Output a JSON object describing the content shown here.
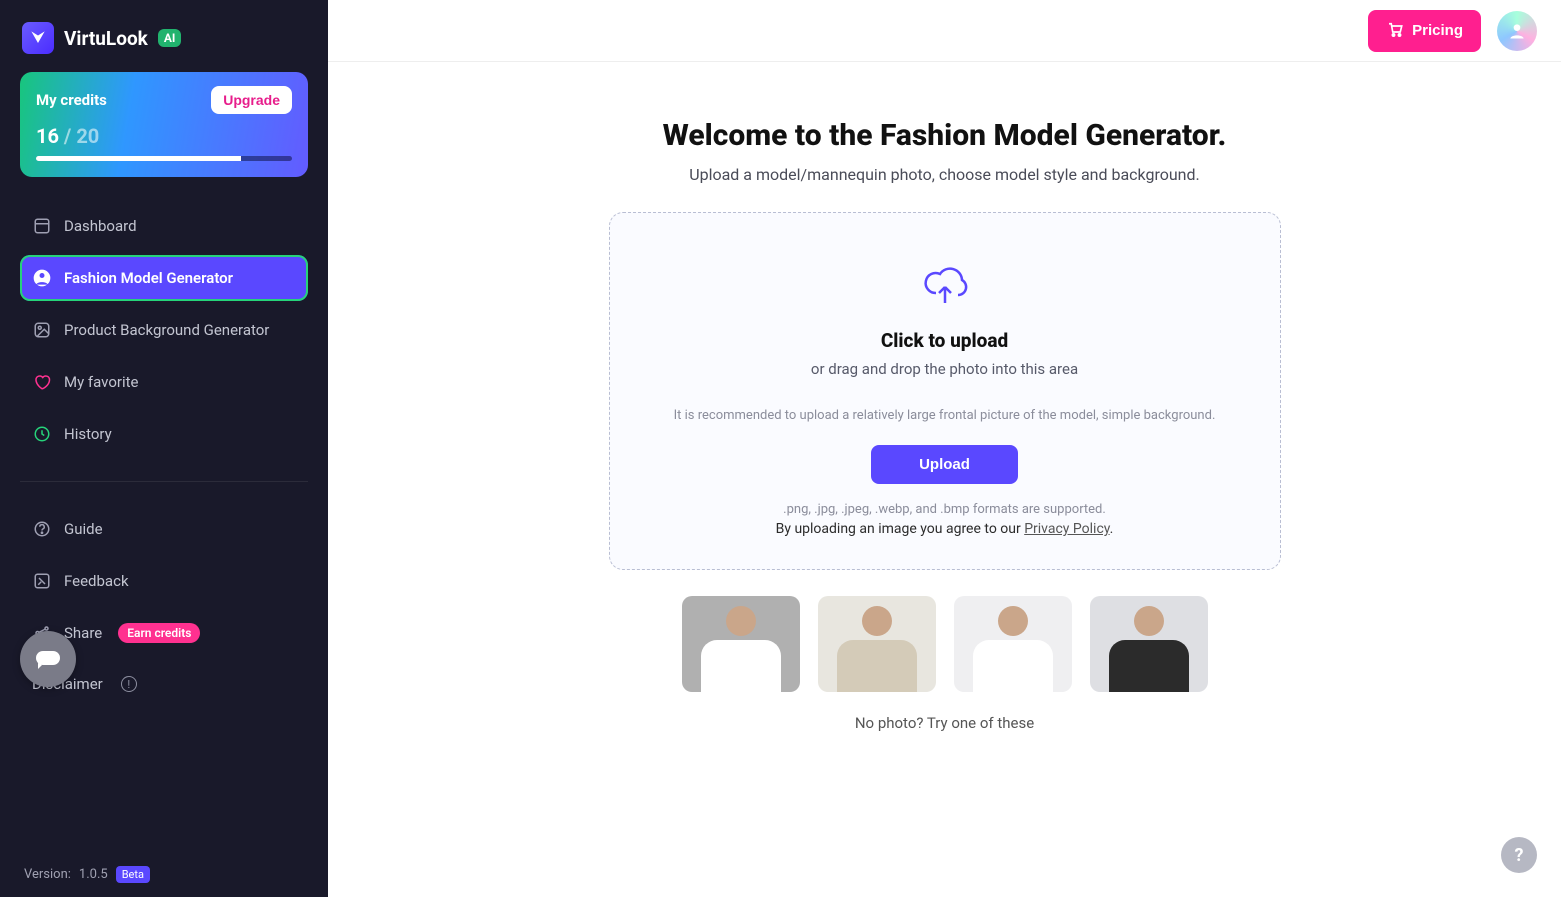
{
  "brand": {
    "name": "VirtuLook",
    "ai_badge": "AI"
  },
  "credits": {
    "title": "My credits",
    "upgrade_label": "Upgrade",
    "used": "16",
    "separator": " / ",
    "total": "20",
    "percent": 80
  },
  "nav": {
    "dashboard": "Dashboard",
    "fashion": "Fashion Model Generator",
    "product_bg": "Product Background Generator",
    "favorite": "My favorite",
    "history": "History",
    "guide": "Guide",
    "feedback": "Feedback",
    "share": "Share",
    "share_badge": "Earn credits",
    "disclaimer": "Disclaimer"
  },
  "version": {
    "prefix": "Version: ",
    "value": "1.0.5",
    "beta": "Beta"
  },
  "topbar": {
    "pricing": "Pricing"
  },
  "main": {
    "title": "Welcome to the Fashion Model Generator.",
    "subtitle": "Upload a model/mannequin photo, choose model style and background.",
    "dz_title": "Click to upload",
    "dz_sub": "or drag and drop the photo into this area",
    "dz_hint": "It is recommended to upload a relatively large frontal picture of the model, simple background.",
    "upload_label": "Upload",
    "formats": ".png, .jpg, .jpeg, .webp, and .bmp formats are supported.",
    "agree_prefix": "By uploading an image you agree to our ",
    "privacy": "Privacy Policy",
    "agree_suffix": ".",
    "no_photo": "No photo? Try one of these"
  },
  "help": {
    "label": "?"
  }
}
